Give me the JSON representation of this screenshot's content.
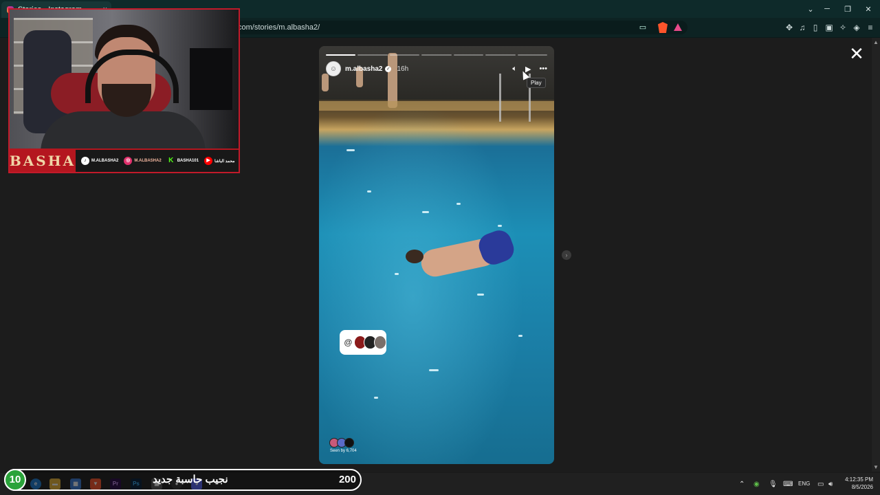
{
  "browser": {
    "tab_title": "Stories • Instagram",
    "tab_close": "×",
    "url": "com/stories/m.albasha2/",
    "window": {
      "minimize": "─",
      "restore": "❐",
      "close": "✕",
      "tabs_menu": "⌄"
    }
  },
  "story": {
    "username": "m.albasha2",
    "time_ago": "16h",
    "tooltip": "Play",
    "seen_by": "Seen by 6,704",
    "segments_total": 7,
    "segments_done": 1
  },
  "overlay": {
    "brand": "BASHA",
    "socials": [
      {
        "icon": "tiktok-icon",
        "label": "M.ALBASHA2",
        "color": "#111111"
      },
      {
        "icon": "instagram-icon",
        "label": "M.ALBASHA2",
        "color": "#e1306c"
      },
      {
        "icon": "kick-icon",
        "label": "BASHA101",
        "color": "#53fc18"
      },
      {
        "icon": "youtube-icon",
        "label": "محمد الباشا",
        "color": "#ff0000"
      }
    ]
  },
  "ticker": {
    "number": "10",
    "message": "نجيب حاسبة جديد",
    "amount": "200"
  },
  "taskbar": {
    "language": "ENG",
    "time": "4:12:35 PM",
    "date": "8/5/2026"
  },
  "colors": {
    "browser_chrome": "#0e2a2a",
    "overlay_red": "#b4161f",
    "ticker_green": "#2aa33a"
  }
}
